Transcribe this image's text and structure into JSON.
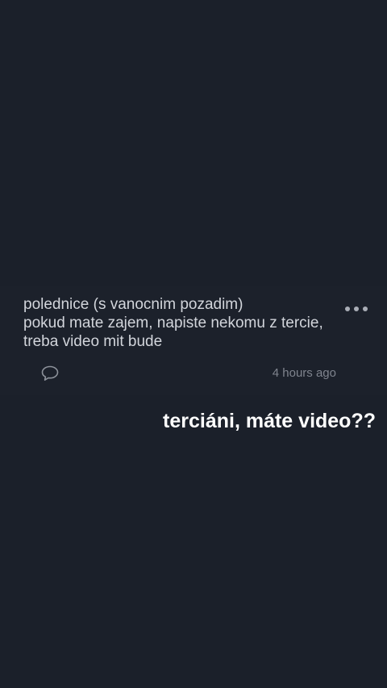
{
  "post": {
    "lines": [
      "polednice (s vanocnim pozadim)",
      "pokud mate zajem, napiste nekomu z tercie,",
      "treba video mit bude"
    ],
    "time": "4 hours ago"
  },
  "icons": {
    "more": "more-dots-icon",
    "comment": "comment-bubble-icon"
  },
  "caption": "terciáni, máte video??",
  "colors": {
    "background": "#1b202a",
    "post_text": "#d2d5db",
    "muted": "#7f848e",
    "caption": "#ffffff"
  }
}
